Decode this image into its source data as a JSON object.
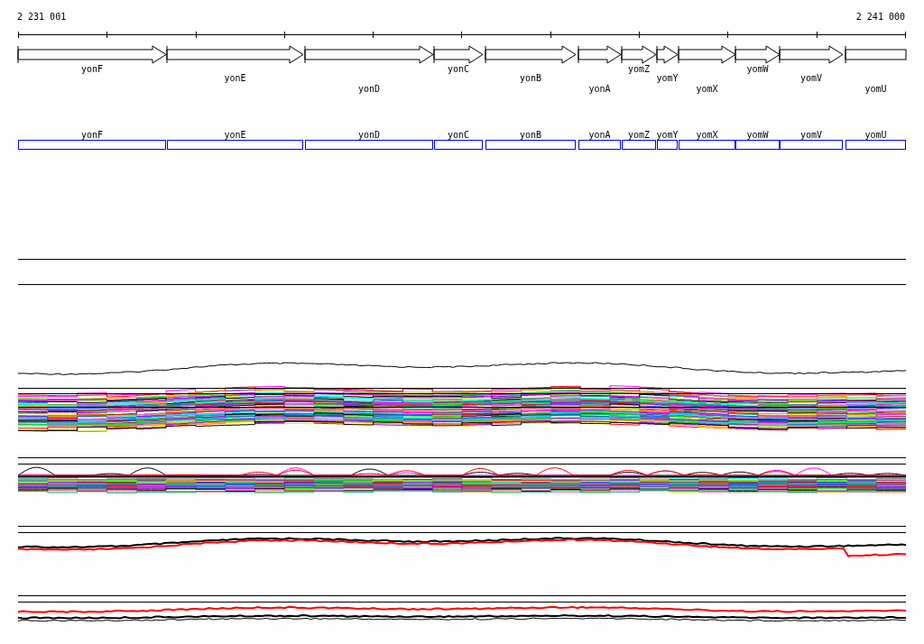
{
  "ruler": {
    "start_label": "2 231 001",
    "end_label": "2 241 000"
  },
  "gene_track": {
    "genes": [
      {
        "name": "yonF",
        "kind": "forward"
      },
      {
        "name": "yonE",
        "kind": "forward"
      },
      {
        "name": "yonD",
        "kind": "forward"
      },
      {
        "name": "yonC",
        "kind": "forward"
      },
      {
        "name": "yonB",
        "kind": "forward"
      },
      {
        "name": "yonA",
        "kind": "forward"
      },
      {
        "name": "yomZ",
        "kind": "forward"
      },
      {
        "name": "yomY",
        "kind": "forward"
      },
      {
        "name": "yomX",
        "kind": "forward"
      },
      {
        "name": "yomW",
        "kind": "forward"
      },
      {
        "name": "yomV",
        "kind": "forward"
      },
      {
        "name": "yomU",
        "kind": "truncated"
      }
    ]
  },
  "annotation_track": {
    "features": [
      {
        "name": "yonF"
      },
      {
        "name": "yonE"
      },
      {
        "name": "yonD"
      },
      {
        "name": "yonC"
      },
      {
        "name": "yonB"
      },
      {
        "name": "yonA"
      },
      {
        "name": "yomZ"
      },
      {
        "name": "yomY"
      },
      {
        "name": "yomX"
      },
      {
        "name": "yomW"
      },
      {
        "name": "yomV"
      },
      {
        "name": "yomU"
      }
    ]
  }
}
